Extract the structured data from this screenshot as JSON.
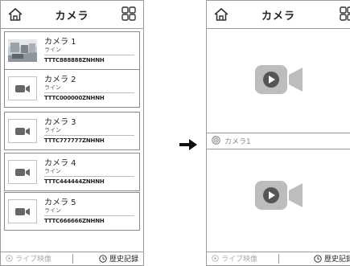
{
  "header": {
    "title": "カメラ"
  },
  "cameras": [
    {
      "name": "カメラ 1",
      "sub": "ライン",
      "serial": "TTTC888888ZNHNH",
      "thumb": "photo"
    },
    {
      "name": "カメラ 2",
      "sub": "ライン",
      "serial": "TTTC000000ZNHNH",
      "thumb": "camera-icon"
    },
    {
      "name": "カメラ 3",
      "sub": "ライン",
      "serial": "TTTC777777ZNHNH",
      "thumb": "camera-icon"
    },
    {
      "name": "カメラ 4",
      "sub": "ライン",
      "serial": "TTTC444444ZNHNH",
      "thumb": "camera-icon"
    },
    {
      "name": "カメラ 5",
      "sub": "ライン",
      "serial": "TTTC666666ZNHNH",
      "thumb": "camera-icon"
    }
  ],
  "footer": {
    "live": "ライブ映像",
    "history": "歴史記録"
  },
  "right": {
    "selected_camera": "カメラ1"
  },
  "colors": {
    "icon_gray": "#bdbdbd",
    "border": "#9a9a9a"
  },
  "icons": [
    "home-icon",
    "grid-icon",
    "video-camera-icon",
    "play-icon",
    "clock-icon",
    "arrow-right-icon",
    "webcam-icon"
  ]
}
